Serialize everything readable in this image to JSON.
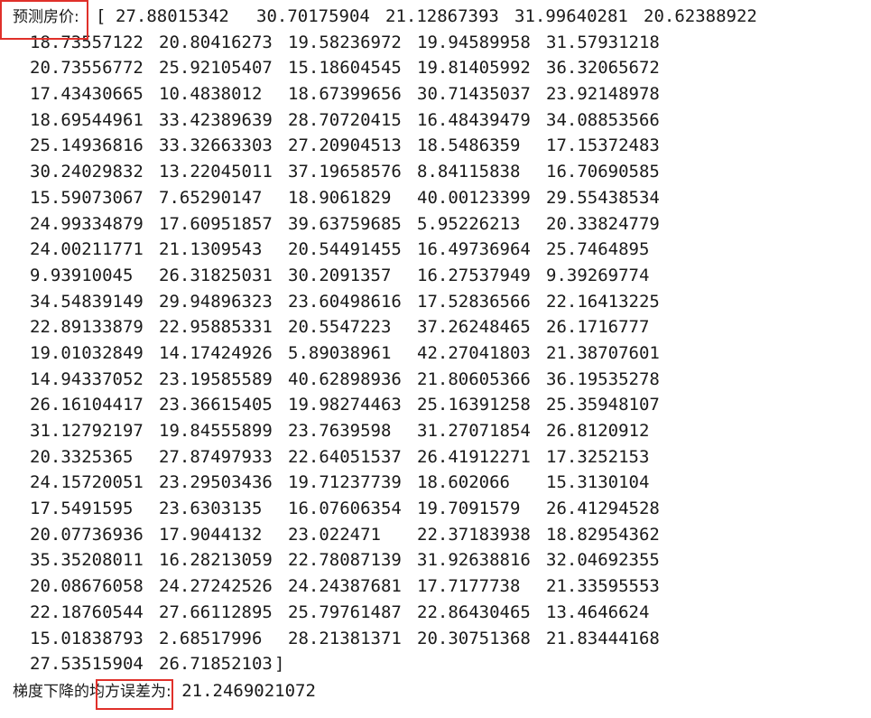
{
  "prediction_label": "预测房价:",
  "open_bracket": "[",
  "close_bracket": "]",
  "predictions": [
    [
      "27.88015342",
      "30.70175904",
      "21.12867393",
      "31.99640281",
      "20.62388922"
    ],
    [
      "18.73557122",
      "20.80416273",
      "19.58236972",
      "19.94589958",
      "31.57931218"
    ],
    [
      "20.73556772",
      "25.92105407",
      "15.18604545",
      "19.81405992",
      "36.32065672"
    ],
    [
      "17.43430665",
      "10.4838012",
      "18.67399656",
      "30.71435037",
      "23.92148978"
    ],
    [
      "18.69544961",
      "33.42389639",
      "28.70720415",
      "16.48439479",
      "34.08853566"
    ],
    [
      "25.14936816",
      "33.32663303",
      "27.20904513",
      "18.5486359",
      "17.15372483"
    ],
    [
      "30.24029832",
      "13.22045011",
      "37.19658576",
      "8.84115838",
      "16.70690585"
    ],
    [
      "15.59073067",
      "7.65290147",
      "18.9061829",
      "40.00123399",
      "29.55438534"
    ],
    [
      "24.99334879",
      "17.60951857",
      "39.63759685",
      "5.95226213",
      "20.33824779"
    ],
    [
      "24.00211771",
      "21.1309543",
      "20.54491455",
      "16.49736964",
      "25.7464895"
    ],
    [
      "9.93910045",
      "26.31825031",
      "30.2091357",
      "16.27537949",
      "9.39269774"
    ],
    [
      "34.54839149",
      "29.94896323",
      "23.60498616",
      "17.52836566",
      "22.16413225"
    ],
    [
      "22.89133879",
      "22.95885331",
      "20.5547223",
      "37.26248465",
      "26.1716777"
    ],
    [
      "19.01032849",
      "14.17424926",
      "5.89038961",
      "42.27041803",
      "21.38707601"
    ],
    [
      "14.94337052",
      "23.19585589",
      "40.62898936",
      "21.80605366",
      "36.19535278"
    ],
    [
      "26.16104417",
      "23.36615405",
      "19.98274463",
      "25.16391258",
      "25.35948107"
    ],
    [
      "31.12792197",
      "19.84555899",
      "23.7639598",
      "31.27071854",
      "26.8120912"
    ],
    [
      "20.3325365",
      "27.87497933",
      "22.64051537",
      "26.41912271",
      "17.3252153"
    ],
    [
      "24.15720051",
      "23.29503436",
      "19.71237739",
      "18.602066",
      "15.3130104"
    ],
    [
      "17.5491595",
      "23.6303135",
      "16.07606354",
      "19.7091579",
      "26.41294528"
    ],
    [
      "20.07736936",
      "17.9044132",
      "23.022471",
      "22.37183938",
      "18.82954362"
    ],
    [
      "35.35208011",
      "16.28213059",
      "22.78087139",
      "31.92638816",
      "32.04692355"
    ],
    [
      "20.08676058",
      "24.27242526",
      "24.24387681",
      "17.7177738",
      "21.33595553"
    ],
    [
      "22.18760544",
      "27.66112895",
      "25.79761487",
      "22.86430465",
      "13.4646624"
    ],
    [
      "15.01838793",
      "2.68517996",
      "28.21381371",
      "20.30751368",
      "21.83444168"
    ],
    [
      "27.53515904",
      "26.71852103"
    ]
  ],
  "mse_label": "梯度下降的均方误差为:",
  "mse_value": "21.2469021072",
  "highlight_color": "#e0302a"
}
